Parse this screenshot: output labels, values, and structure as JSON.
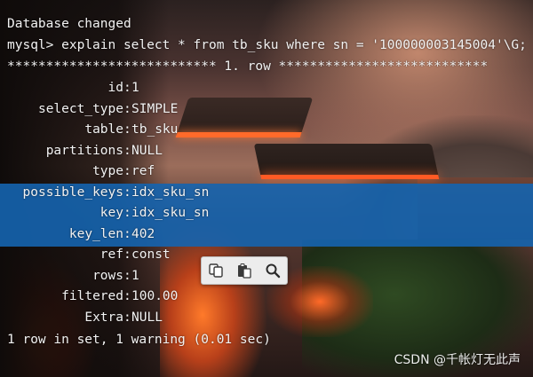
{
  "terminal": {
    "status_line": "Database changed",
    "prompt": "mysql> ",
    "command": "explain select * from tb_sku where sn = '100000003145004'\\G;",
    "row_header": "*************************** 1. row ***************************",
    "fields": [
      {
        "label": "id",
        "value": "1"
      },
      {
        "label": "select_type",
        "value": "SIMPLE"
      },
      {
        "label": "table",
        "value": "tb_sku"
      },
      {
        "label": "partitions",
        "value": "NULL"
      },
      {
        "label": "type",
        "value": "ref"
      },
      {
        "label": "possible_keys",
        "value": "idx_sku_sn"
      },
      {
        "label": "key",
        "value": "idx_sku_sn"
      },
      {
        "label": "key_len",
        "value": "402"
      },
      {
        "label": "ref",
        "value": "const"
      },
      {
        "label": "rows",
        "value": "1"
      },
      {
        "label": "filtered",
        "value": "100.00"
      },
      {
        "label": "Extra",
        "value": "NULL"
      }
    ],
    "footer": "1 row in set, 1 warning (0.01 sec)",
    "selected_rows": [
      "possible_keys",
      "key",
      "key_len"
    ]
  },
  "toolbar": {
    "buttons": [
      {
        "icon": "copy-icon"
      },
      {
        "icon": "paste-icon"
      },
      {
        "icon": "search-icon"
      }
    ]
  },
  "watermark": "CSDN @千帐灯无此声",
  "colors": {
    "text": "#f2f2f2",
    "selection": "#1564af",
    "toolbar_bg": "#ececec"
  }
}
